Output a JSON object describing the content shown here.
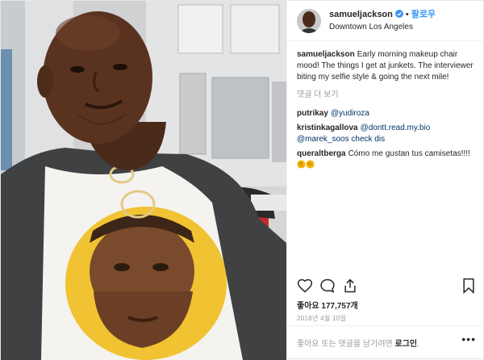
{
  "post": {
    "username": "samueljackson",
    "follow_label": "팔로우",
    "dot": "•",
    "location": "Downtown Los Angeles",
    "caption_user": "samueljackson",
    "caption_text": "Early morning makeup chair mood! The things I get at junkets. The interviewer biting my selfie style & going the next mile!",
    "more_comments": "댓글 더 보기",
    "comments": [
      {
        "user": "putrikay",
        "text": "@yudiroza"
      },
      {
        "user": "kristinkagallova",
        "text": "@dontt.read.my.bio"
      },
      {
        "text": "@marek_soos check dis"
      },
      {
        "user": "queraltberga",
        "text": "Cómo me gustan tus camisetas!!!!"
      }
    ],
    "likes": "좋아요 177,757개",
    "date": "2018년 4월 10일",
    "add_comment_prefix": "좋아요 또는 댓글을 남기려면 ",
    "login_label": "로그인",
    "add_comment_suffix": ".",
    "more_menu": "•••"
  },
  "colors": {
    "link_blue": "#3897f0",
    "mention": "#003569",
    "text": "#262626",
    "muted": "#999999"
  },
  "icons": [
    "verified-badge-icon",
    "heart-icon",
    "comment-icon",
    "share-icon",
    "bookmark-icon",
    "clapping-hands-emoji"
  ]
}
